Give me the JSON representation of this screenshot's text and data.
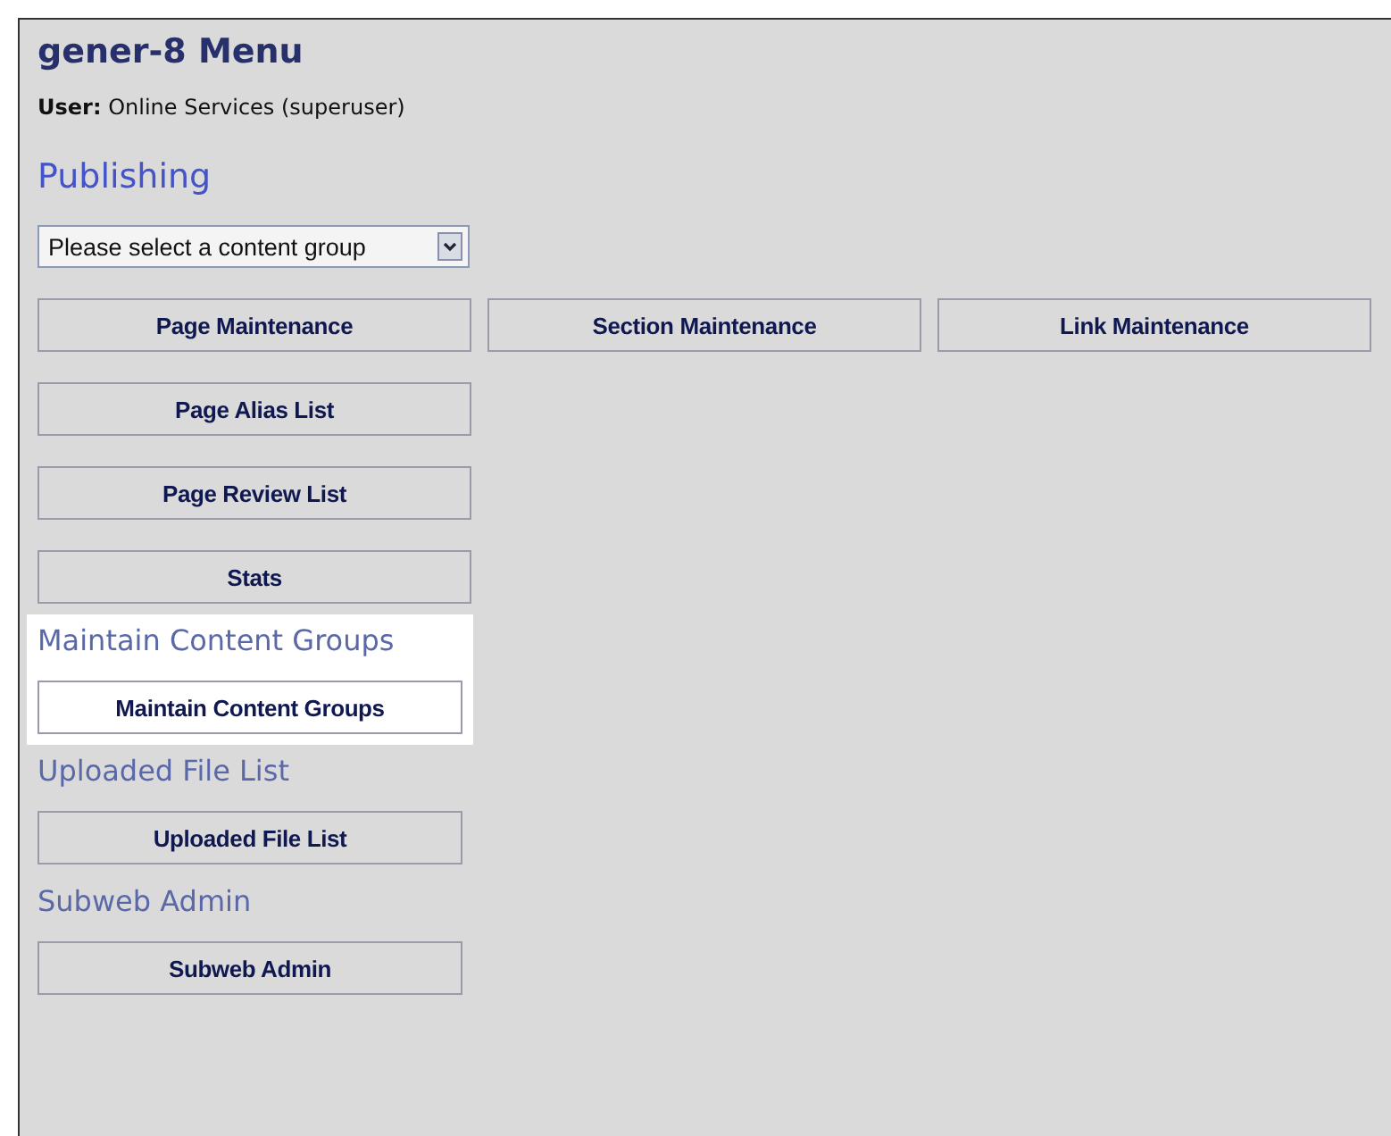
{
  "title": "gener-8 Menu",
  "user": {
    "label": "User:",
    "value": "Online Services (superuser)"
  },
  "sections": [
    {
      "heading": "Publishing",
      "highlighted": false,
      "select": {
        "value": "Please select a content group"
      },
      "button_rows": [
        [
          "Page Maintenance",
          "Section Maintenance",
          "Link Maintenance"
        ],
        [
          "Page Alias List"
        ],
        [
          "Page Review List"
        ],
        [
          "Stats"
        ]
      ]
    },
    {
      "heading": "Maintain Content Groups",
      "highlighted": true,
      "button_rows": [
        [
          "Maintain Content Groups"
        ]
      ]
    },
    {
      "heading": "Uploaded File List",
      "highlighted": false,
      "button_rows": [
        [
          "Uploaded File List"
        ]
      ]
    },
    {
      "heading": "Subweb Admin",
      "highlighted": false,
      "button_rows": [
        [
          "Subweb Admin"
        ]
      ]
    }
  ]
}
